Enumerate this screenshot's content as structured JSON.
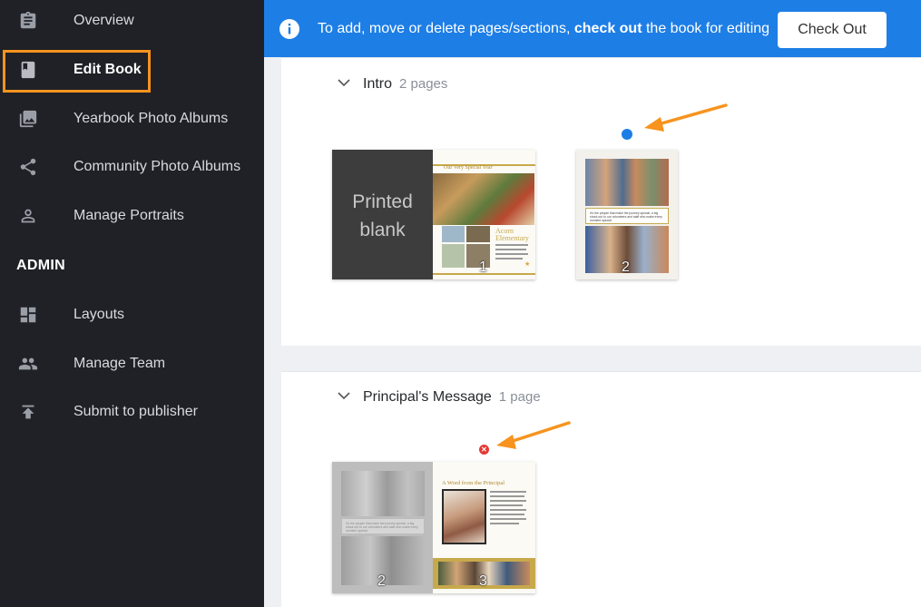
{
  "sidebar": {
    "items": [
      {
        "label": "Overview",
        "icon": "clipboard-icon"
      },
      {
        "label": "Edit Book",
        "icon": "book-icon",
        "active": true
      },
      {
        "label": "Yearbook Photo Albums",
        "icon": "photo-library-icon"
      },
      {
        "label": "Community Photo Albums",
        "icon": "share-icon"
      },
      {
        "label": "Manage Portraits",
        "icon": "person-icon"
      }
    ],
    "admin_header": "ADMIN",
    "admin_items": [
      {
        "label": "Layouts",
        "icon": "dashboard-icon"
      },
      {
        "label": "Manage Team",
        "icon": "people-icon"
      },
      {
        "label": "Submit to publisher",
        "icon": "upload-icon"
      }
    ]
  },
  "banner": {
    "message_prefix": "To add, move or delete pages/sections, ",
    "message_bold": "check out",
    "message_suffix": " the book for editing",
    "button_label": "Check Out"
  },
  "sections": [
    {
      "title": "Intro",
      "count": "2 pages",
      "spreads": [
        {
          "left_text_line1": "Printed",
          "left_text_line2": "blank",
          "page_header": "Our Very Special Year",
          "page_subhead_line1": "Acorn",
          "page_subhead_line2": "Elementary",
          "page_number": "1"
        },
        {
          "page_number": "2",
          "caption": "It's the people that make the journey special, a big shout-out to our volunteers and staff who make every moment special."
        }
      ]
    },
    {
      "title": "Principal's Message",
      "count": "1 page",
      "spreads": [
        {
          "left_page_number": "2",
          "right_page_number": "3",
          "page_header": "A Word from the Principal",
          "ghost_caption": "It's the people that make the journey special, a big shout-out to our volunteers and staff who make every moment special."
        }
      ]
    }
  ],
  "colors": {
    "accent": "#1d7ee6",
    "highlight": "#f7931e",
    "sidebar_bg": "#1f2126",
    "error": "#e53935"
  }
}
